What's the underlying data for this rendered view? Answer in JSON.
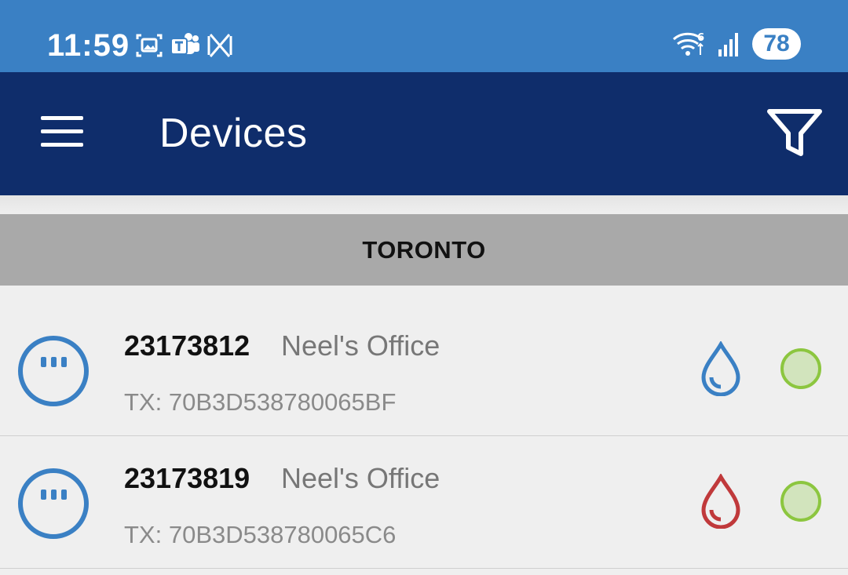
{
  "status_bar": {
    "time": "11:59",
    "battery": "78",
    "icons_left": [
      "screenshot-icon",
      "teams-icon",
      "app-x-icon"
    ],
    "icons_right": [
      "wifi-6-icon",
      "signal-icon",
      "battery-icon"
    ]
  },
  "app_bar": {
    "title": "Devices",
    "menu_icon": "hamburger-menu-icon",
    "filter_icon": "filter-icon"
  },
  "section": {
    "header": "TORONTO"
  },
  "devices": [
    {
      "id": "23173812",
      "name": "Neel's Office",
      "tx": "TX: 70B3D538780065BF",
      "drop_icon": "water-drop-icon",
      "drop_color": "#3a80c4",
      "status_color": "#8cc63f"
    },
    {
      "id": "23173819",
      "name": "Neel's Office",
      "tx": "TX: 70B3D538780065C6",
      "drop_icon": "water-drop-icon",
      "drop_color": "#c0393b",
      "status_color": "#8cc63f"
    }
  ],
  "colors": {
    "status_bar": "#3a80c4",
    "app_bar": "#0f2d6b",
    "section_header": "#a9a9a9",
    "device_icon": "#3a80c4"
  }
}
